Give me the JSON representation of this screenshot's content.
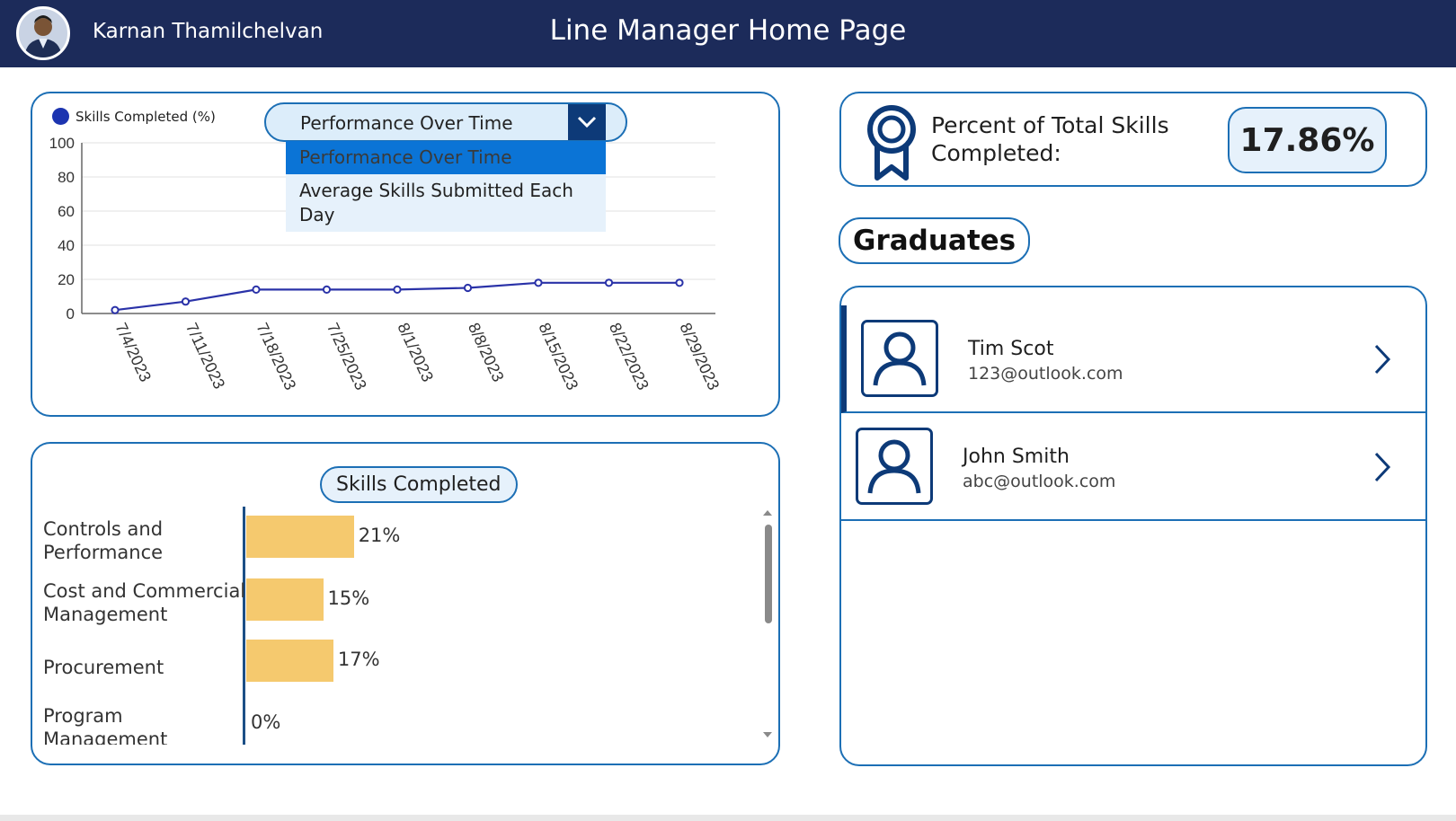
{
  "header": {
    "user_name": "Karnan Thamilchelvan",
    "title": "Line Manager Home Page"
  },
  "performance_card": {
    "dropdown": {
      "value": "Performance Over Time",
      "options": [
        "Performance Over Time",
        "Average Skills Submitted Each Day"
      ],
      "selected_index": 0
    }
  },
  "skills_card": {
    "title": "Skills Completed"
  },
  "percent_card": {
    "label_line1": "Percent of Total Skills",
    "label_line2": "Completed:",
    "value": "17.86%"
  },
  "graduates": {
    "heading": "Graduates",
    "items": [
      {
        "name": "Tim Scot",
        "email": "123@outlook.com",
        "active": true
      },
      {
        "name": "John Smith",
        "email": "abc@outlook.com",
        "active": false
      }
    ]
  },
  "colors": {
    "header_bg": "#1c2b5a",
    "accent_border": "#1c6fb5",
    "line_series": "#2a32a8",
    "bar_fill": "#f5c96e"
  },
  "chart_data": [
    {
      "type": "line",
      "legend": [
        "Skills Completed (%)"
      ],
      "legend_position": "top-left",
      "x": [
        "7/4/2023",
        "7/11/2023",
        "7/18/2023",
        "7/25/2023",
        "8/1/2023",
        "8/8/2023",
        "8/15/2023",
        "8/22/2023",
        "8/29/2023"
      ],
      "series": [
        {
          "name": "Skills Completed (%)",
          "values": [
            2,
            7,
            14,
            14,
            14,
            15,
            18,
            18,
            18
          ]
        }
      ],
      "yticks": [
        0,
        20,
        40,
        60,
        80,
        100
      ],
      "ylim": [
        0,
        100
      ],
      "grid": true
    },
    {
      "type": "bar",
      "orientation": "horizontal",
      "title": "Skills Completed",
      "categories": [
        "Controls and Performance",
        "Cost and Commercial Management",
        "Procurement",
        "Program Management"
      ],
      "category_lines": [
        [
          "Controls and",
          "Performance"
        ],
        [
          "Cost and Commercial",
          "Management"
        ],
        [
          "Procurement"
        ],
        [
          "Program",
          "Management"
        ]
      ],
      "values": [
        21,
        15,
        17,
        0
      ],
      "value_labels": [
        "21%",
        "15%",
        "17%",
        "0%"
      ],
      "xlim": [
        0,
        100
      ]
    }
  ]
}
